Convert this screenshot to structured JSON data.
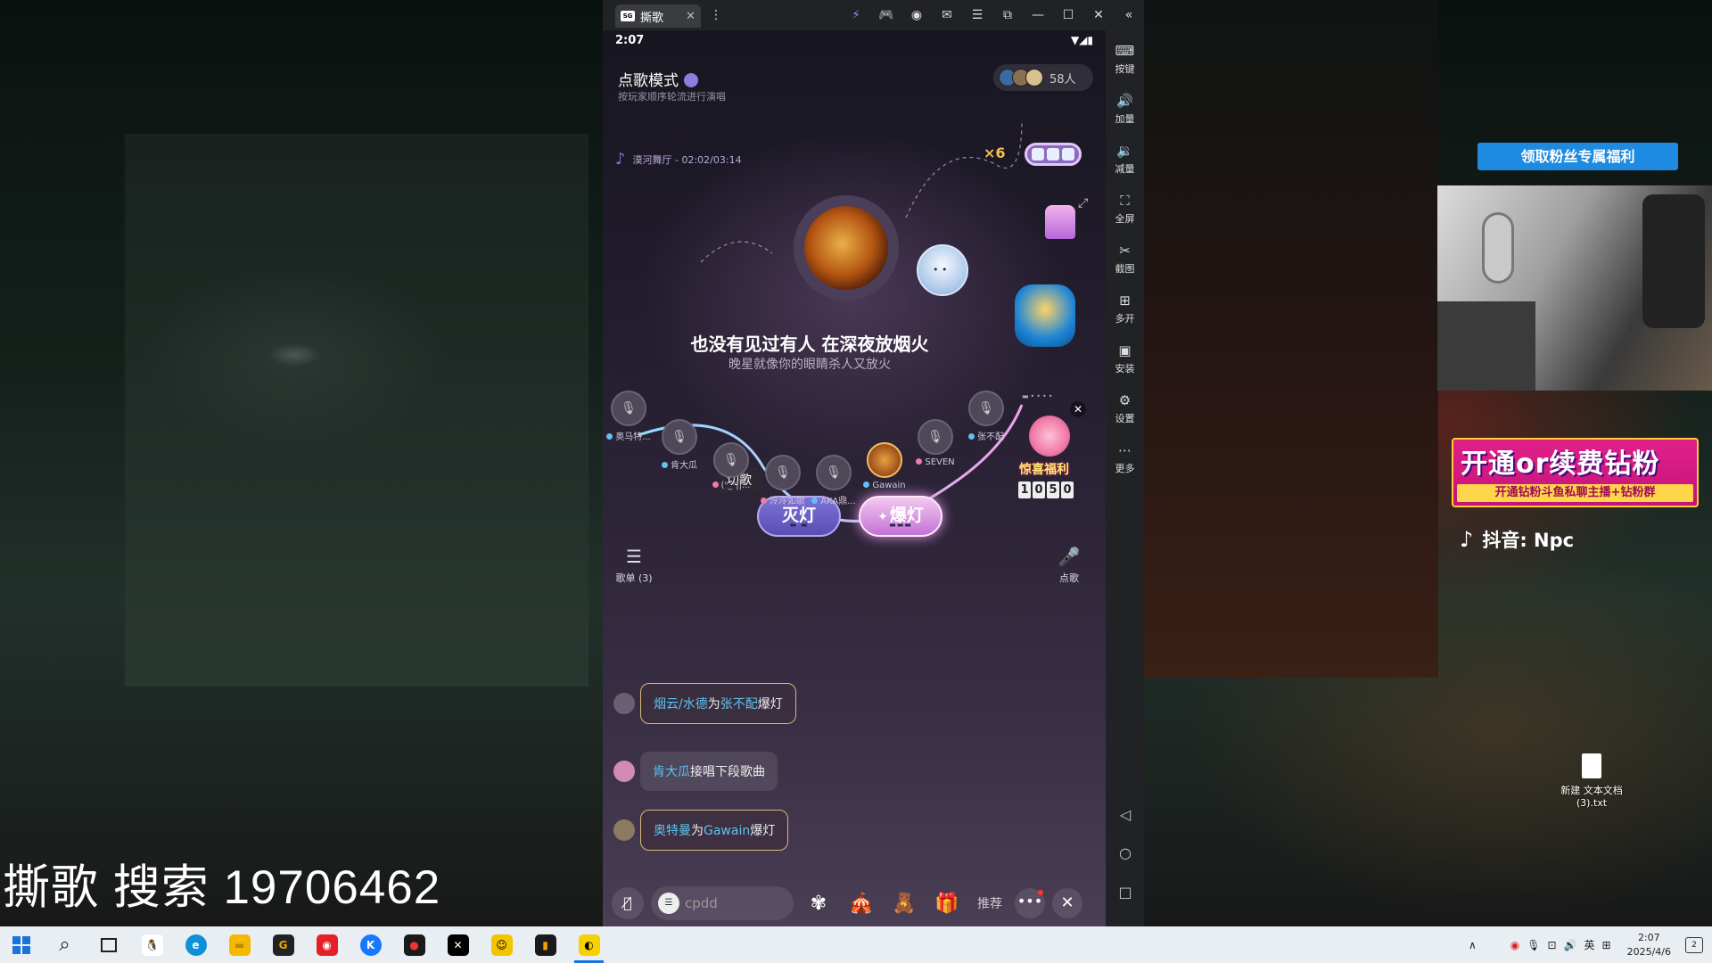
{
  "emulator": {
    "tab_title": "撕歌",
    "tab_logo": "SG",
    "sidebar": [
      {
        "label": "按键",
        "icon": "keyboard-icon"
      },
      {
        "label": "加量",
        "icon": "volume-up-icon"
      },
      {
        "label": "减量",
        "icon": "volume-down-icon"
      },
      {
        "label": "全屏",
        "icon": "fullscreen-icon"
      },
      {
        "label": "截图",
        "icon": "scissors-icon"
      },
      {
        "label": "多开",
        "icon": "multi-open-icon"
      },
      {
        "label": "安装",
        "icon": "apk-install-icon"
      },
      {
        "label": "设置",
        "icon": "settings-icon"
      },
      {
        "label": "更多",
        "icon": "more-icon"
      }
    ]
  },
  "phone": {
    "status_time": "2:07",
    "room": {
      "title": "点歌模式",
      "subtitle": "按玩家顺序轮流进行演唱",
      "audience_count": "58人"
    },
    "now_playing": {
      "song": "漠河舞厅 - 02:02/03:14",
      "combo": "×6",
      "lyric_current": "也没有见过有人 在深夜放烟火",
      "lyric_next": "晚星就像你的眼睛杀人又放火"
    },
    "gift_banner": "惊喜福利",
    "timer_digits": [
      "1",
      "0",
      "5",
      "0"
    ],
    "cut_song_label": "切歌",
    "buttons": {
      "lights_off": "灭灯",
      "lights_burst": "爆灯"
    },
    "seats": [
      {
        "name": "奥马特...",
        "dot": "#5fc2f0"
      },
      {
        "name": "肯大瓜",
        "dot": "#5fc2f0"
      },
      {
        "name": "(ᐢ_ᐢ||...",
        "dot": "#f07aa8"
      },
      {
        "name": "泠泠如歌",
        "dot": "#f07aa8"
      },
      {
        "name": "AKA鼎...",
        "dot": "#5fc2f0"
      },
      {
        "name": "Gawain",
        "dot": "#5fc2f0"
      },
      {
        "name": "SEVEN",
        "dot": "#f07aa8"
      },
      {
        "name": "张不配",
        "dot": "#5fc2f0"
      }
    ],
    "songlist_label": "歌单 (3)",
    "pick_label": "点歌",
    "chat": [
      {
        "user": "烟云/水德",
        "mid": "为",
        "target": "张不配",
        "action": "爆灯"
      },
      {
        "user": "肯大瓜",
        "mid": "接唱下段歌曲",
        "target": "",
        "action": ""
      },
      {
        "user": "奥特曼",
        "mid": "为",
        "target": "Gawain",
        "action": "爆灯"
      }
    ],
    "input_placeholder": "cpdd",
    "recommend_label": "推荐"
  },
  "overlays": {
    "fans_button": "领取粉丝专属福利",
    "promo_title": "开通or续费钻粉",
    "promo_sub": "开通钻粉斗鱼私聊主播+钻粉群",
    "douyin": "抖音: Npc",
    "stream_text": "撕歌 搜索 19706462",
    "desktop_file": "新建 文本文档 (3).txt"
  },
  "taskbar": {
    "apps": [
      {
        "name": "qq",
        "glyph": "🐧",
        "color": "#111"
      },
      {
        "name": "edge",
        "glyph": "e",
        "color": "#0f8fd6"
      },
      {
        "name": "explorer",
        "glyph": "▬",
        "color": "#f5b800"
      },
      {
        "name": "app-g",
        "glyph": "G",
        "color": "#222"
      },
      {
        "name": "netease-music",
        "glyph": "◉",
        "color": "#e32026"
      },
      {
        "name": "kugou",
        "glyph": "K",
        "color": "#1677ff"
      },
      {
        "name": "app-circle",
        "glyph": "●",
        "color": "#1a1a1a"
      },
      {
        "name": "capcut",
        "glyph": "✕",
        "color": "#000"
      },
      {
        "name": "game-face",
        "glyph": "☺",
        "color": "#f5c400"
      },
      {
        "name": "audio-app",
        "glyph": "▮",
        "color": "#1a1a1a"
      },
      {
        "name": "sige",
        "glyph": "◐",
        "color": "#f5d100"
      }
    ],
    "ime": "英",
    "time": "2:07",
    "date": "2025/4/6",
    "notification_count": "2"
  }
}
